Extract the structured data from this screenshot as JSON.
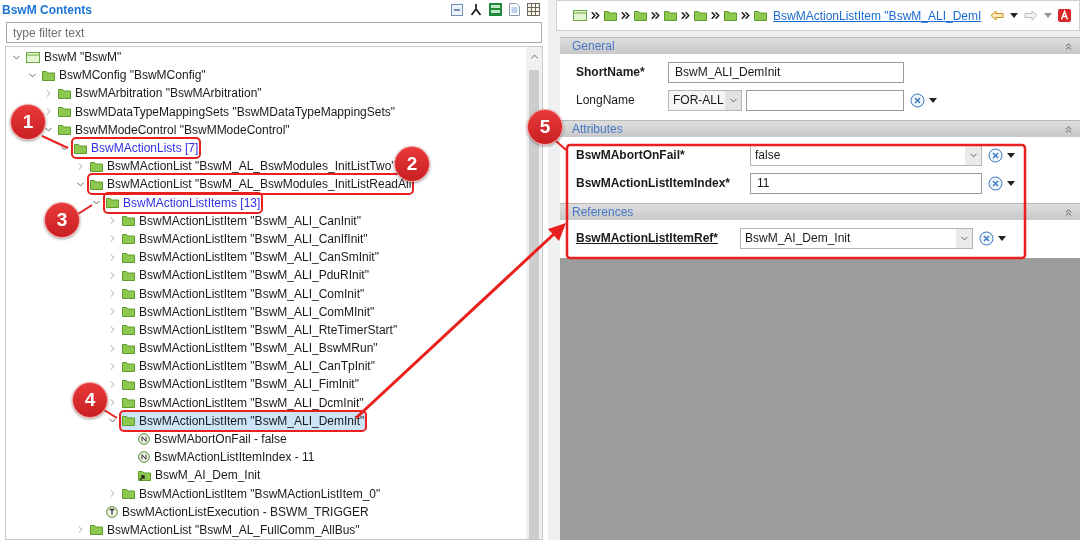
{
  "tree_panel": {
    "title": "BswM Contents",
    "filter": {
      "placeholder": "type filter text"
    },
    "tree": [
      {
        "kind": "module",
        "label": "BswM \"BswM\"",
        "expanded": true,
        "selected": false,
        "outlined": false,
        "children": [
          {
            "kind": "container",
            "label": "BswMConfig \"BswMConfig\"",
            "expanded": true,
            "selected": false,
            "outlined": false,
            "children": [
              {
                "kind": "container",
                "label": "BswMArbitration \"BswMArbitration\"",
                "expanded": false,
                "selected": false,
                "outlined": false
              },
              {
                "kind": "container",
                "label": "BswMDataTypeMappingSets \"BswMDataTypeMappingSets\"",
                "expanded": false,
                "selected": false,
                "outlined": false
              },
              {
                "kind": "container",
                "label": "BswMModeControl \"BswMModeControl\"",
                "expanded": true,
                "selected": false,
                "outlined": false,
                "children": [
                  {
                    "kind": "list",
                    "label": "BswMActionLists [7]",
                    "expanded": true,
                    "selected": false,
                    "outlined": true,
                    "children": [
                      {
                        "kind": "container",
                        "label": "BswMActionList \"BswM_AL_BswModules_InitListTwo\"",
                        "expanded": false,
                        "selected": false,
                        "outlined": false
                      },
                      {
                        "kind": "container",
                        "label": "BswMActionList \"BswM_AL_BswModules_InitListReadAll",
                        "expanded": true,
                        "selected": false,
                        "outlined": true,
                        "children": [
                          {
                            "kind": "list",
                            "label": "BswMActionListItems [13]",
                            "expanded": true,
                            "selected": false,
                            "outlined": true,
                            "children": [
                              {
                                "kind": "container",
                                "label": "BswMActionListItem \"BswM_ALI_CanInit\"",
                                "expanded": false,
                                "selected": false,
                                "outlined": false
                              },
                              {
                                "kind": "container",
                                "label": "BswMActionListItem \"BswM_ALI_CanIfInit\"",
                                "expanded": false,
                                "selected": false,
                                "outlined": false
                              },
                              {
                                "kind": "container",
                                "label": "BswMActionListItem \"BswM_ALI_CanSmInit\"",
                                "expanded": false,
                                "selected": false,
                                "outlined": false
                              },
                              {
                                "kind": "container",
                                "label": "BswMActionListItem \"BswM_ALI_PduRInit\"",
                                "expanded": false,
                                "selected": false,
                                "outlined": false
                              },
                              {
                                "kind": "container",
                                "label": "BswMActionListItem \"BswM_ALI_ComInit\"",
                                "expanded": false,
                                "selected": false,
                                "outlined": false
                              },
                              {
                                "kind": "container",
                                "label": "BswMActionListItem \"BswM_ALI_ComMInit\"",
                                "expanded": false,
                                "selected": false,
                                "outlined": false
                              },
                              {
                                "kind": "container",
                                "label": "BswMActionListItem \"BswM_ALI_RteTimerStart\"",
                                "expanded": false,
                                "selected": false,
                                "outlined": false
                              },
                              {
                                "kind": "container",
                                "label": "BswMActionListItem \"BswM_ALI_BswMRun\"",
                                "expanded": false,
                                "selected": false,
                                "outlined": false
                              },
                              {
                                "kind": "container",
                                "label": "BswMActionListItem \"BswM_ALI_CanTpInit\"",
                                "expanded": false,
                                "selected": false,
                                "outlined": false
                              },
                              {
                                "kind": "container",
                                "label": "BswMActionListItem \"BswM_ALI_FimInit\"",
                                "expanded": false,
                                "selected": false,
                                "outlined": false
                              },
                              {
                                "kind": "container",
                                "label": "BswMActionListItem \"BswM_ALI_DcmInit\"",
                                "expanded": false,
                                "selected": false,
                                "outlined": false
                              },
                              {
                                "kind": "container",
                                "label": "BswMActionListItem \"BswM_ALI_DemInit\"",
                                "expanded": true,
                                "selected": true,
                                "outlined": true,
                                "children": [
                                  {
                                    "kind": "param",
                                    "label": "BswMAbortOnFail - false",
                                    "selected": false,
                                    "outlined": false
                                  },
                                  {
                                    "kind": "param",
                                    "label": "BswMActionListItemIndex - 11",
                                    "selected": false,
                                    "outlined": false
                                  },
                                  {
                                    "kind": "reference",
                                    "label": "BswM_AI_Dem_Init",
                                    "selected": false,
                                    "outlined": false
                                  }
                                ]
                              },
                              {
                                "kind": "container",
                                "label": "BswMActionListItem \"BswMActionListItem_0\"",
                                "expanded": false,
                                "selected": false,
                                "outlined": false
                              }
                            ]
                          },
                          {
                            "kind": "enum",
                            "label": "BswMActionListExecution - BSWM_TRIGGER",
                            "selected": false,
                            "outlined": false
                          }
                        ]
                      },
                      {
                        "kind": "container",
                        "label": "BswMActionList \"BswM_AL_FullComm_AllBus\"",
                        "expanded": false,
                        "selected": false,
                        "outlined": false
                      }
                    ]
                  }
                ]
              }
            ]
          }
        ]
      }
    ]
  },
  "editor": {
    "breadcrumb": {
      "path": [
        {
          "kind": "module"
        },
        {
          "kind": "container"
        },
        {
          "kind": "container"
        },
        {
          "kind": "container"
        },
        {
          "kind": "container"
        },
        {
          "kind": "container"
        },
        {
          "kind": "container"
        }
      ],
      "link": "BswMActionListItem \"BswM_ALI_DemI"
    },
    "sections": [
      {
        "title": "General",
        "fields": [
          {
            "kind": "text",
            "label": "ShortName*",
            "required": true,
            "value": "BswM_ALI_DemInit",
            "config_button": false
          },
          {
            "kind": "lang-text",
            "label": "LongName",
            "required": false,
            "language": "FOR-ALL",
            "config_button": true
          }
        ]
      },
      {
        "title": "Attributes",
        "fields": [
          {
            "kind": "select",
            "label": "BswMAbortOnFail*",
            "required": true,
            "value": "false",
            "config_button": true
          },
          {
            "kind": "text",
            "label": "BswMActionListItemIndex*",
            "required": true,
            "value": "11",
            "config_button": true
          }
        ]
      },
      {
        "title": "References",
        "fields": [
          {
            "kind": "reference",
            "label": "BswMActionListItemRef*",
            "required": true,
            "value": "BswM_AI_Dem_Init",
            "config_button": true
          }
        ]
      }
    ]
  },
  "callouts": [
    {
      "number": "1"
    },
    {
      "number": "2"
    },
    {
      "number": "3"
    },
    {
      "number": "4"
    },
    {
      "number": "5"
    }
  ]
}
